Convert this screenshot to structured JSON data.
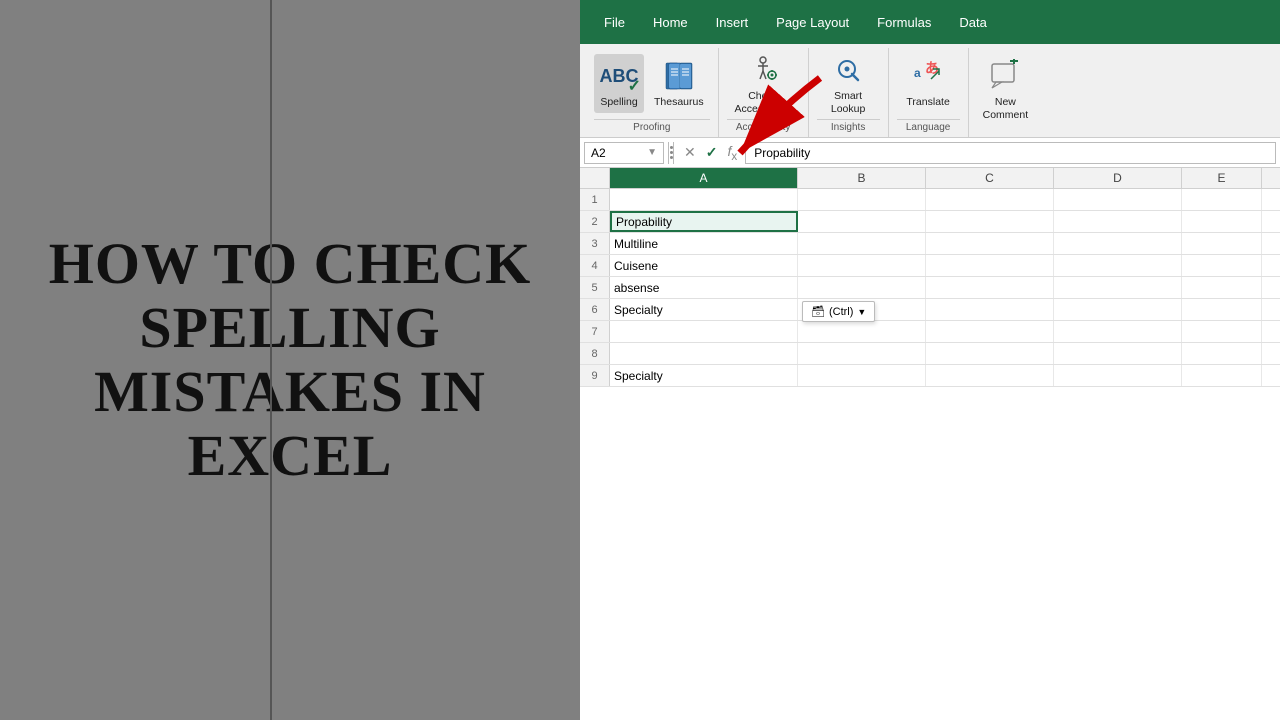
{
  "leftPanel": {
    "title": "HOW TO CHECK SPELLING MISTAKES IN EXCEL"
  },
  "menuBar": {
    "items": [
      "File",
      "Home",
      "Insert",
      "Page Layout",
      "Formulas",
      "Data"
    ]
  },
  "ribbon": {
    "groups": [
      {
        "label": "Proofing",
        "buttons": [
          {
            "id": "spelling",
            "label": "Spelling",
            "icon": "spelling"
          },
          {
            "id": "thesaurus",
            "label": "Thesaurus",
            "icon": "📖"
          }
        ]
      },
      {
        "label": "Accessibility",
        "buttons": [
          {
            "id": "check-accessibility",
            "label": "Check\nAccessibility",
            "icon": "⚙"
          }
        ]
      },
      {
        "label": "Insights",
        "buttons": [
          {
            "id": "smart-lookup",
            "label": "Smart\nLookup",
            "icon": "smart"
          }
        ]
      },
      {
        "label": "Language",
        "buttons": [
          {
            "id": "translate",
            "label": "Translate",
            "icon": "translate"
          }
        ]
      },
      {
        "label": "",
        "buttons": [
          {
            "id": "new-comment",
            "label": "New\nComment",
            "icon": "💬"
          }
        ]
      }
    ]
  },
  "formulaBar": {
    "cellRef": "A2",
    "content": "Propability"
  },
  "columns": [
    "A",
    "B",
    "C",
    "D",
    "E"
  ],
  "rows": [
    {
      "num": "1",
      "cells": [
        "",
        "",
        "",
        "",
        ""
      ]
    },
    {
      "num": "2",
      "cells": [
        "Propability",
        "",
        "",
        "",
        ""
      ],
      "selected": true
    },
    {
      "num": "3",
      "cells": [
        "Multiline",
        "",
        "",
        "",
        ""
      ]
    },
    {
      "num": "4",
      "cells": [
        "Cuisene",
        "",
        "",
        "",
        ""
      ]
    },
    {
      "num": "5",
      "cells": [
        "absense",
        "",
        "",
        "",
        ""
      ]
    },
    {
      "num": "6",
      "cells": [
        "Specialty",
        "",
        "",
        "",
        ""
      ]
    },
    {
      "num": "7",
      "cells": [
        "",
        "",
        "",
        "",
        ""
      ]
    },
    {
      "num": "8",
      "cells": [
        "",
        "",
        "",
        "",
        ""
      ]
    },
    {
      "num": "9",
      "cells": [
        "Specialty",
        "",
        "",
        "",
        ""
      ]
    }
  ],
  "pastePopup": {
    "label": "(Ctrl)",
    "dropdownArrow": "▼"
  },
  "colors": {
    "excelGreen": "#1e7145",
    "ribbonBg": "#f0f0f0",
    "activeColHeader": "#1e7145"
  }
}
